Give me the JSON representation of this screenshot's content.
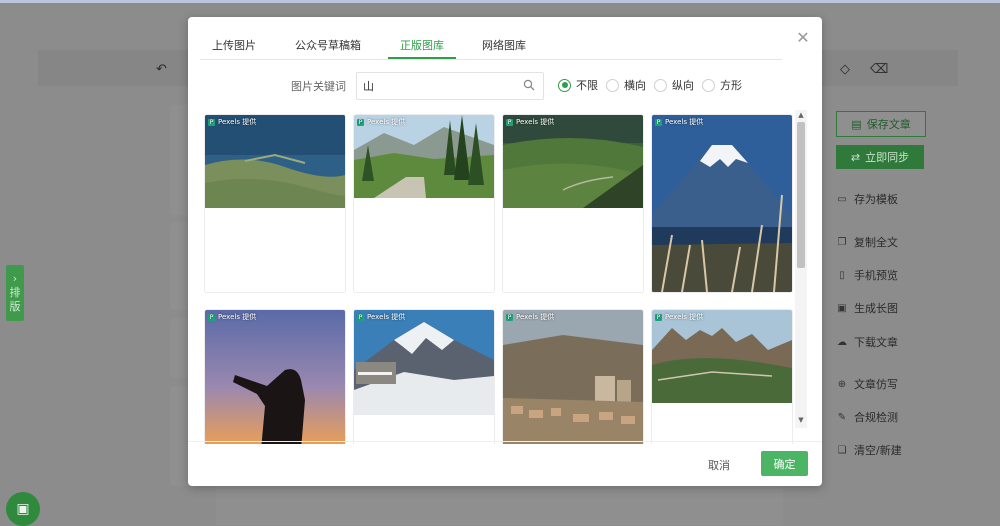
{
  "background": {
    "toolbar_icons": [
      "undo-icon",
      "clear-format-icon",
      "eraser-icon"
    ],
    "float_tab_label": [
      "排",
      "版"
    ],
    "right_sidebar": {
      "save_article": "保存文章",
      "sync_now": "立即同步",
      "items": [
        {
          "icon": "template-icon",
          "label": "存为模板"
        },
        {
          "icon": "copy-icon",
          "label": "复制全文"
        },
        {
          "icon": "phone-icon",
          "label": "手机预览"
        },
        {
          "icon": "image-icon",
          "label": "生成长图"
        },
        {
          "icon": "download-icon",
          "label": "下载文章"
        },
        {
          "icon": "imitate-icon",
          "label": "文章仿写"
        },
        {
          "icon": "check-icon",
          "label": "合规检测"
        },
        {
          "icon": "clear-icon",
          "label": "清空/新建"
        }
      ]
    }
  },
  "dialog": {
    "tabs": [
      "上传图片",
      "公众号草稿箱",
      "正版图库",
      "网络图库"
    ],
    "active_tab": 2,
    "search": {
      "label": "图片关键词",
      "value": "山",
      "placeholder": ""
    },
    "orientation": {
      "options": [
        "不限",
        "横向",
        "纵向",
        "方形"
      ],
      "selected": 0
    },
    "images": [
      {
        "source": "Pexels 提供",
        "scene": "lake-hills"
      },
      {
        "source": "Pexels 提供",
        "scene": "forest-road"
      },
      {
        "source": "Pexels 提供",
        "scene": "green-valley"
      },
      {
        "source": "Pexels 提供",
        "scene": "mount-fuji"
      },
      {
        "source": "Pexels 提供",
        "scene": "sunset-silhouette"
      },
      {
        "source": "Pexels 提供",
        "scene": "snow-peaks"
      },
      {
        "source": "Pexels 提供",
        "scene": "hillside-town"
      },
      {
        "source": "Pexels 提供",
        "scene": "cliff-walkway"
      }
    ],
    "cancel_label": "取消",
    "confirm_label": "确定"
  },
  "colors": {
    "accent": "#2e9e4a",
    "confirm_button": "#4bb565"
  }
}
